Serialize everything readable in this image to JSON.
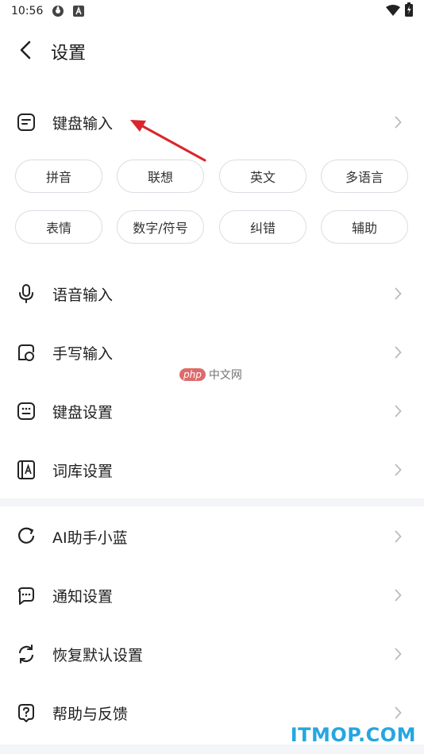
{
  "status_bar": {
    "time": "10:56"
  },
  "header": {
    "title": "设置"
  },
  "keyboard_section": {
    "label": "键盘输入",
    "chips": [
      "拼音",
      "联想",
      "英文",
      "多语言",
      "表情",
      "数字/符号",
      "纠错",
      "辅助"
    ]
  },
  "group1": [
    {
      "label": "语音输入",
      "icon": "microphone-icon"
    },
    {
      "label": "手写输入",
      "icon": "handwriting-icon"
    },
    {
      "label": "键盘设置",
      "icon": "keyboard-icon"
    },
    {
      "label": "词库设置",
      "icon": "dictionary-icon"
    }
  ],
  "group2": [
    {
      "label": "AI助手小蓝",
      "icon": "ai-assistant-icon"
    },
    {
      "label": "通知设置",
      "icon": "notification-icon"
    },
    {
      "label": "恢复默认设置",
      "icon": "reset-icon"
    },
    {
      "label": "帮助与反馈",
      "icon": "help-icon"
    }
  ],
  "watermark": {
    "php": "php",
    "cn": "中文网"
  },
  "footer_logo": "ITMOP.COM",
  "colors": {
    "annotation_arrow": "#d9262b",
    "logo": "#26a6e0",
    "divider": "#f3f5f8"
  }
}
